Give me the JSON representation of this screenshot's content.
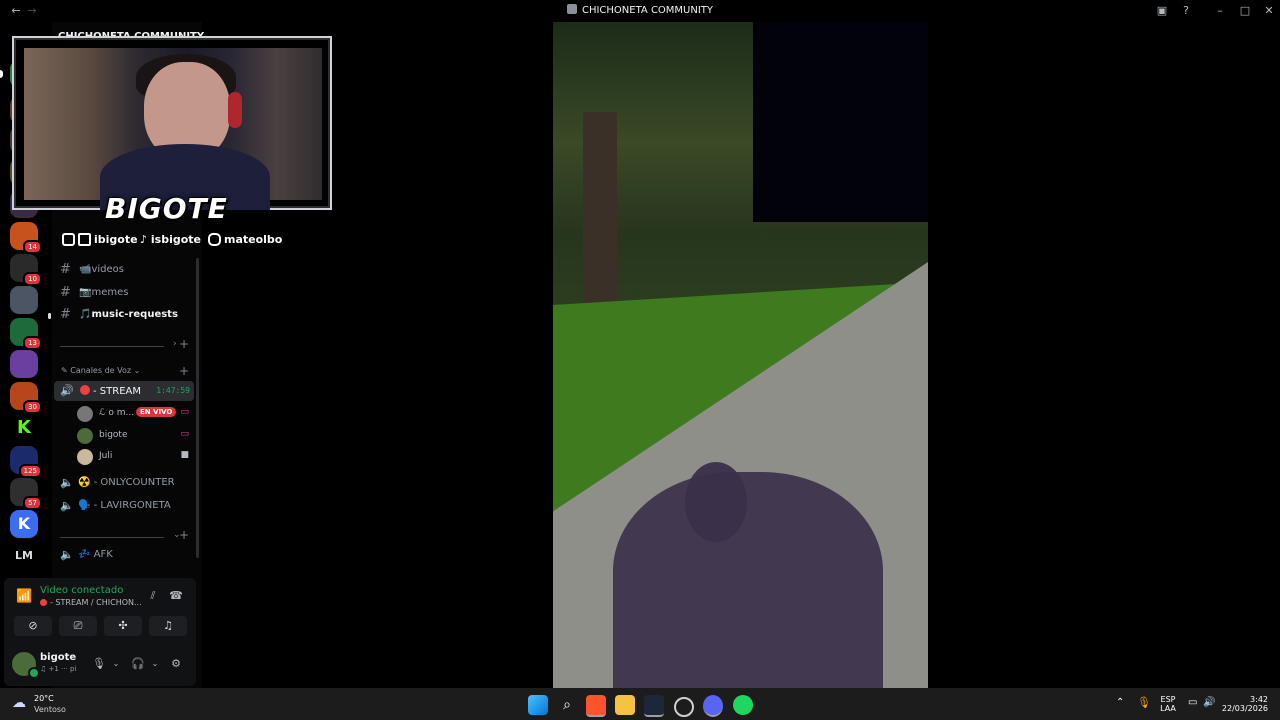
{
  "window": {
    "title": "CHICHONETA COMMUNITY"
  },
  "server": {
    "name": "CHICHONETA COMMUNITY"
  },
  "rail_badges": [
    "14",
    "10",
    "13",
    "30",
    "125",
    "57"
  ],
  "rail_lm": "LM",
  "overlay": {
    "logo": "BIGOTE",
    "twitch": "ibigote",
    "tiktok": "isbigote",
    "instagram": "mateolbo"
  },
  "channels": [
    {
      "emoji": "📹",
      "name": "videos"
    },
    {
      "emoji": "📷",
      "name": "memes"
    },
    {
      "emoji": "🎵",
      "name": "music-requests"
    }
  ],
  "voice_category": "Canales de Voz",
  "voice_channels": {
    "stream": {
      "name": "- STREAM",
      "timer": "1:47:59"
    },
    "onlycounter": {
      "name": "☢️ - ONLYCOUNTER"
    },
    "lavirgoneta": {
      "name": "🗣️ - LAVIRGONETA"
    },
    "afk": {
      "name": "💤 AFK"
    }
  },
  "stream_users": [
    {
      "name": "ℒ o m...",
      "badge": "EN VIVO"
    },
    {
      "name": "bigote"
    },
    {
      "name": "Juli"
    }
  ],
  "voice_panel": {
    "status": "Video conectado",
    "location": "- STREAM / CHICHON..."
  },
  "user_panel": {
    "username": "bigote",
    "status": "♫ +1 ··· pi"
  },
  "taskbar": {
    "temp": "20°C",
    "weather": "Ventoso",
    "lang": "ESP",
    "layout": "LAA",
    "time": "3:42",
    "date": "22/03/2026"
  }
}
